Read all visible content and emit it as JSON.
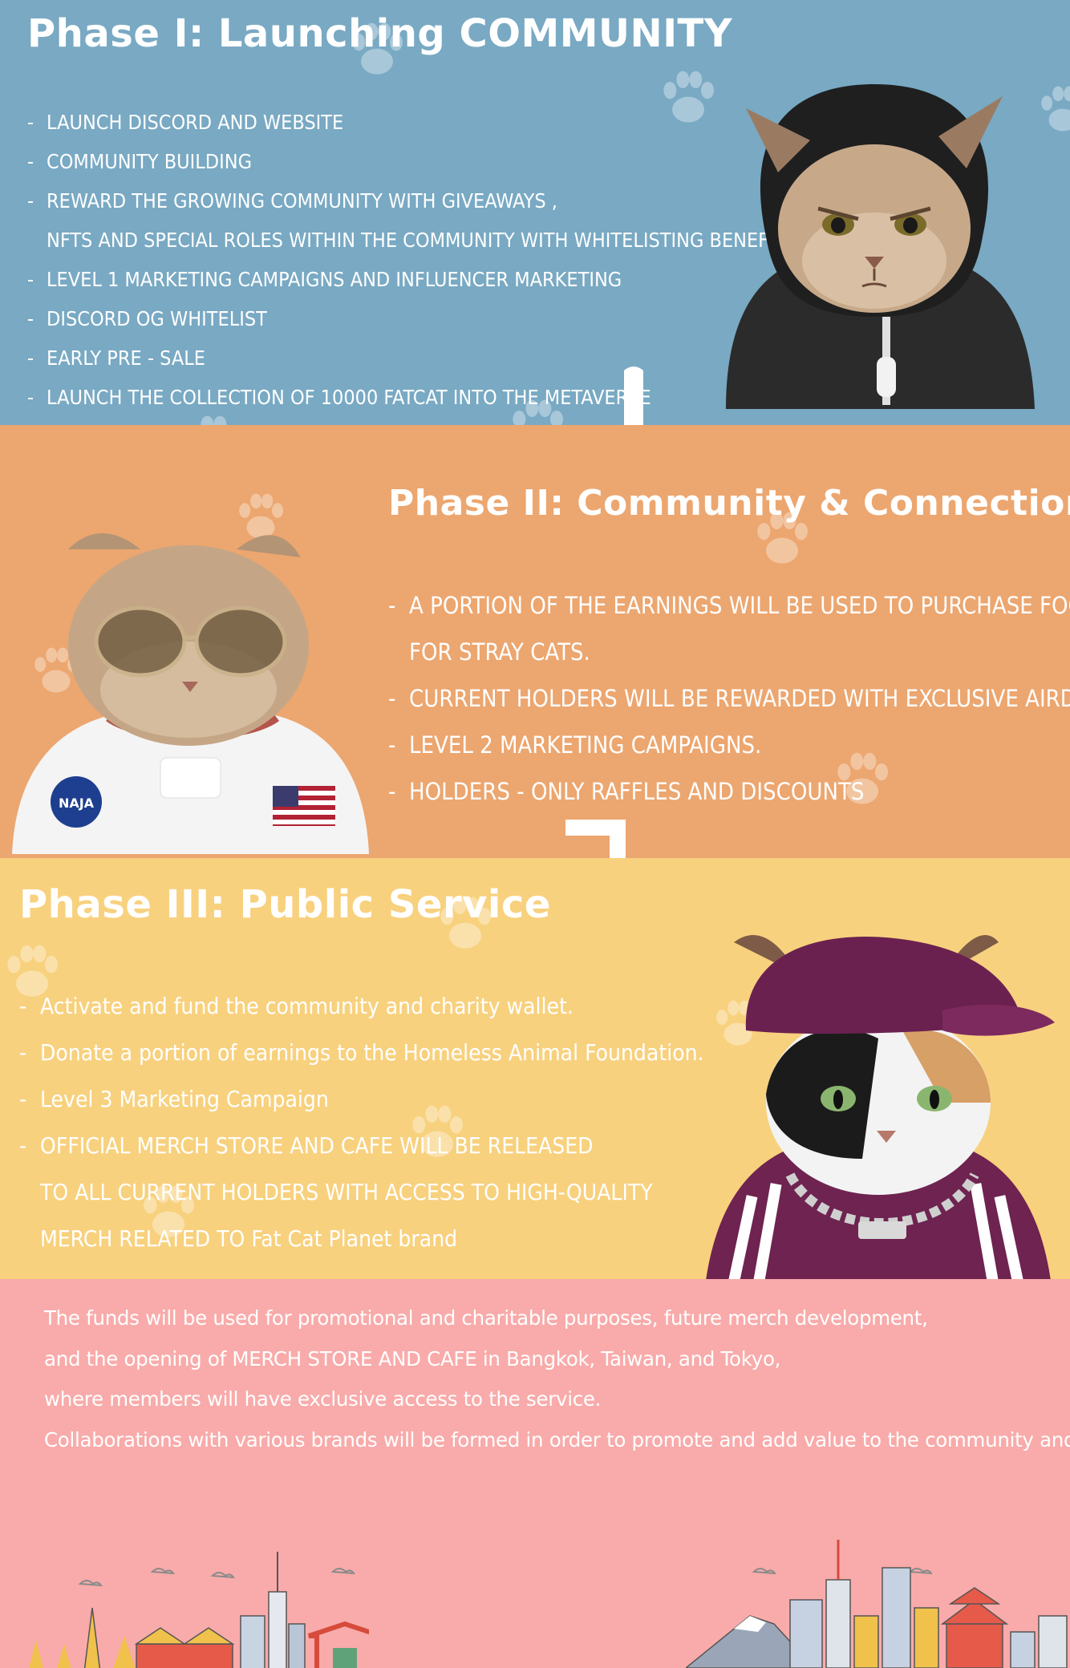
{
  "phase1": {
    "title": "Phase I: Launching COMMUNITY",
    "items": [
      {
        "dash": "-",
        "text": "LAUNCH DISCORD AND WEBSITE"
      },
      {
        "dash": "-",
        "text": "COMMUNITY BUILDING"
      },
      {
        "dash": "-",
        "text": "REWARD THE GROWING COMMUNITY WITH GIVEAWAYS ,"
      },
      {
        "dash": "",
        "text": "NFTS AND SPECIAL ROLES WITHIN THE COMMUNITY WITH WHITELISTING BENEFITS."
      },
      {
        "dash": "-",
        "text": "LEVEL 1 MARKETING CAMPAIGNS AND INFLUENCER MARKETING"
      },
      {
        "dash": "-",
        "text": "DISCORD OG WHITELIST"
      },
      {
        "dash": "-",
        "text": "EARLY PRE - SALE"
      },
      {
        "dash": "-",
        "text": "LAUNCH THE COLLECTION OF 10000 FATCAT INTO THE METAVERSE"
      }
    ]
  },
  "phase2": {
    "title": "Phase II: Community & Connection",
    "items": [
      {
        "dash": "-",
        "text": "A PORTION OF THE EARNINGS WILL BE USED TO PURCHASE FOOD"
      },
      {
        "dash": "",
        "text": "FOR STRAY CATS."
      },
      {
        "dash": "-",
        "text": "CURRENT HOLDERS WILL BE REWARDED WITH EXCLUSIVE AIRDROPS"
      },
      {
        "dash": "-",
        "text": "LEVEL 2 MARKETING CAMPAIGNS."
      },
      {
        "dash": "-",
        "text": "HOLDERS - ONLY RAFFLES AND DISCOUNTS"
      }
    ],
    "badge_nasa": "NAJA"
  },
  "phase3": {
    "title": "Phase III:  Public Service",
    "items": [
      {
        "dash": "-",
        "text": "Activate and fund the community and charity wallet."
      },
      {
        "dash": "-",
        "text": "Donate a portion of earnings to the Homeless Animal Foundation."
      },
      {
        "dash": "-",
        "text": "Level 3 Marketing Campaign"
      },
      {
        "dash": "-",
        "text": "OFFICIAL MERCH STORE AND CAFE WILL BE RELEASED"
      },
      {
        "dash": "",
        "text": "TO ALL CURRENT HOLDERS WITH ACCESS TO HIGH-QUALITY"
      },
      {
        "dash": "",
        "text": "MERCH RELATED TO Fat Cat Planet brand"
      }
    ]
  },
  "footer": {
    "lines": [
      "The funds will be used for promotional and charitable purposes, future merch development,",
      "and the opening of MERCH STORE AND CAFE in Bangkok, Taiwan, and Tokyo,",
      "where members will have exclusive access to the service.",
      "Collaborations with various brands will be formed in order to promote and add value to the community and NFT"
    ]
  },
  "colors": {
    "phase1_bg": "#79a9c3",
    "phase2_bg": "#eca66f",
    "phase3_bg": "#f8d17e",
    "footer_bg": "#f8abaa"
  }
}
